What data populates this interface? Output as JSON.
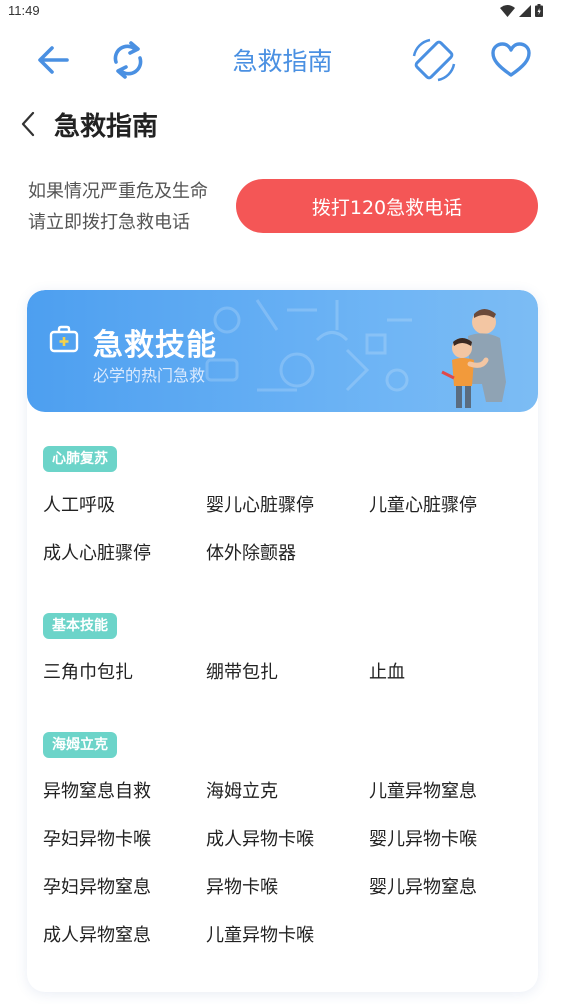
{
  "status": {
    "time": "11:49"
  },
  "toolbar": {
    "title": "急救指南"
  },
  "page": {
    "title": "急救指南"
  },
  "warning": {
    "line1": "如果情况严重危及生命",
    "line2": "请立即拨打急救电话"
  },
  "call_button": {
    "label": "拨打120急救电话"
  },
  "banner": {
    "title": "急救技能",
    "subtitle": "必学的热门急救"
  },
  "sections": [
    {
      "tag": "心肺复苏",
      "items": [
        "人工呼吸",
        "婴儿心脏骤停",
        "儿童心脏骤停",
        "成人心脏骤停",
        "体外除颤器"
      ]
    },
    {
      "tag": "基本技能",
      "items": [
        "三角巾包扎",
        "绷带包扎",
        "止血"
      ]
    },
    {
      "tag": "海姆立克",
      "items": [
        "异物窒息自救",
        "海姆立克",
        "儿童异物窒息",
        "孕妇异物卡喉",
        "成人异物卡喉",
        "婴儿异物卡喉",
        "孕妇异物窒息",
        "异物卡喉",
        "婴儿异物窒息",
        "成人异物窒息",
        "儿童异物卡喉"
      ]
    }
  ],
  "colors": {
    "accent": "#4a90e2",
    "call": "#f45656",
    "tag": "#6cd4c9",
    "banner": "#4d9ff0"
  },
  "icons": [
    "back-arrow-icon",
    "rotate-icon",
    "screen-rotate-icon",
    "heart-icon",
    "chevron-left-icon",
    "first-aid-kit-icon",
    "wifi-icon",
    "signal-icon",
    "battery-icon"
  ]
}
